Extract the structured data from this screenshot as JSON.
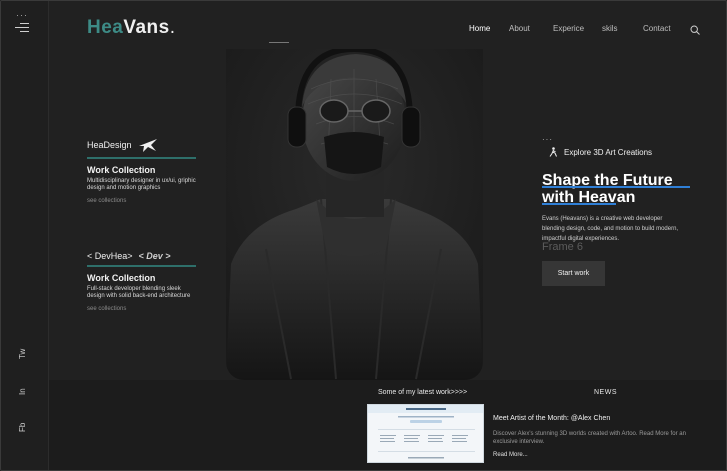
{
  "sidebar": {
    "dots": "···",
    "social": [
      "Tw",
      "In",
      "Fb"
    ],
    "bottom_dots": "• • •"
  },
  "logo": {
    "part1": "Hea",
    "part2": "Vans",
    "dot": "."
  },
  "nav": [
    "Home",
    "About",
    "Experice",
    "skils",
    "Contact"
  ],
  "left_cards": [
    {
      "heading": "HeaDesign",
      "title": "Work Collection",
      "desc": "Multidisciplinary designer in ux/ui, griphic design and motion graphics",
      "link": "see collections"
    },
    {
      "heading": "< DevHea>",
      "badge": "< Dev >",
      "title": "Work Collection",
      "desc": "Full-stack developer blending sleek design with solid back-end architecture",
      "link": "see collections"
    }
  ],
  "right": {
    "dots": "···",
    "explore": "Explore 3D Art Creations",
    "headline_line1": "Shape the Future",
    "headline_line2": "with Heavan",
    "description": "Evans (Heavans) is a creative web developer blending design, code, and motion to build modern, impactful digital experiences.",
    "frame_label": "Frame 6",
    "cta": "Start work"
  },
  "bottom": {
    "latest": "Some of my latest work>>>>",
    "news_label": "NEWS",
    "article_title": "Meet Artist of the Month: @Alex Chen",
    "article_desc": "Discover Alex's stunning 3D worlds created with Artoo. Read More for an exclusive interview.",
    "read_more": "Read More..."
  },
  "colors": {
    "accent_blue": "#2f7fd6",
    "accent_teal": "#2e6f6a",
    "bg": "#212121"
  }
}
